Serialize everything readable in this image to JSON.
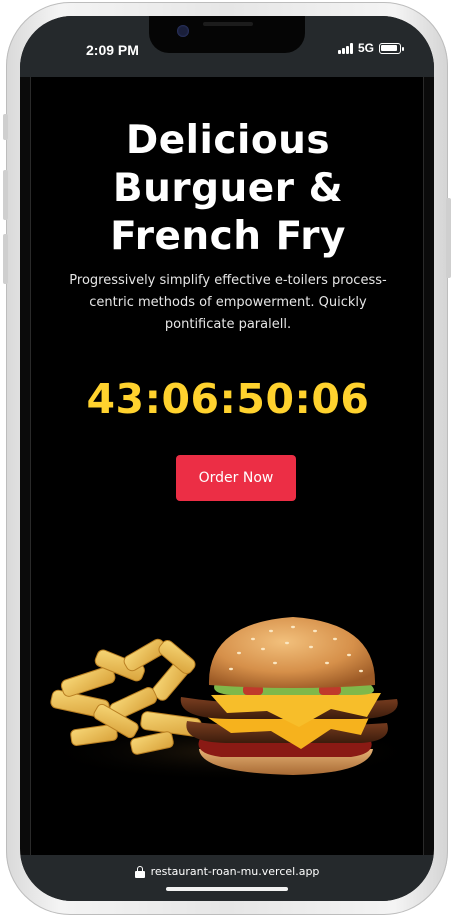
{
  "status_bar": {
    "time": "2:09 PM",
    "network": "5G"
  },
  "hero": {
    "title_lines": [
      "Delicious",
      "Burguer &",
      "French Fry"
    ],
    "description_lines": [
      "Progressively simplify effective e-toilers process-",
      "centric methods of empowerment. Quickly",
      "pontificate paralell."
    ],
    "countdown": "43:06:50:06",
    "order_button_label": "Order Now"
  },
  "image": {
    "subject": "burger-and-fries"
  },
  "browser": {
    "url": "restaurant-roan-mu.vercel.app"
  },
  "colors": {
    "countdown": "#ffd22e",
    "button": "#ec2e45",
    "background": "#000000",
    "status_bar": "#25292c"
  }
}
